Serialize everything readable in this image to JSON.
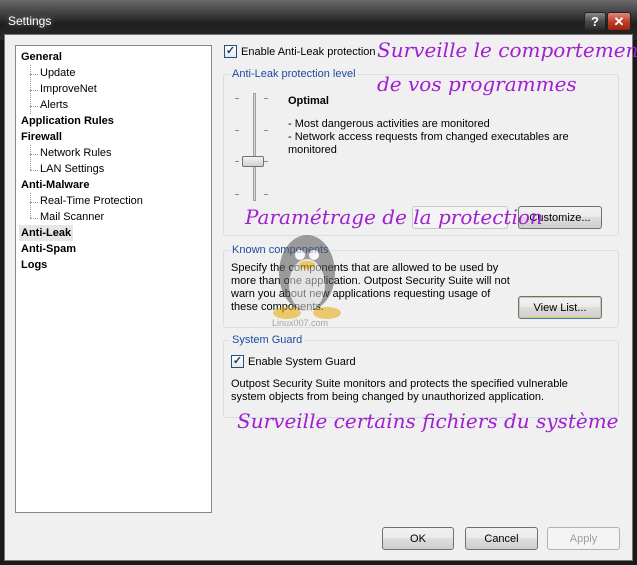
{
  "window": {
    "title": "Settings"
  },
  "titlebar": {
    "help_label": "?",
    "close_label": "✕"
  },
  "tree": {
    "items": [
      {
        "label": "General",
        "level": 0
      },
      {
        "label": "Update",
        "level": 1
      },
      {
        "label": "ImproveNet",
        "level": 1
      },
      {
        "label": "Alerts",
        "level": 1
      },
      {
        "label": "Application Rules",
        "level": 0
      },
      {
        "label": "Firewall",
        "level": 0
      },
      {
        "label": "Network Rules",
        "level": 1
      },
      {
        "label": "LAN Settings",
        "level": 1
      },
      {
        "label": "Anti-Malware",
        "level": 0
      },
      {
        "label": "Real-Time Protection",
        "level": 1
      },
      {
        "label": "Mail Scanner",
        "level": 1
      },
      {
        "label": "Anti-Leak",
        "level": 0,
        "selected": true
      },
      {
        "label": "Anti-Spam",
        "level": 0
      },
      {
        "label": "Logs",
        "level": 0
      }
    ]
  },
  "antileak": {
    "enable_label": "Enable Anti-Leak protection",
    "enabled": true,
    "level_title": "Anti-Leak protection level",
    "level_name": "Optimal",
    "level_desc_1": "- Most dangerous activities are monitored",
    "level_desc_2": "- Network access requests from changed executables are monitored",
    "customize_label": "Customize..."
  },
  "known_components": {
    "title": "Known components",
    "description": "Specify the components that are allowed to be used by more than one application. Outpost Security Suite will not warn you about new applications requesting usage of these components.",
    "view_list_label": "View List..."
  },
  "system_guard": {
    "title": "System Guard",
    "enable_label": "Enable System Guard",
    "enabled": true,
    "description": "Outpost Security Suite monitors and protects the specified vulnerable system objects from being changed by unauthorized application."
  },
  "footer": {
    "ok_label": "OK",
    "cancel_label": "Cancel",
    "apply_label": "Apply"
  },
  "annotations": {
    "a1": "Surveille le comportement",
    "a2": "de vos programmes",
    "a3": "Paramétrage de la protection",
    "a4": "Surveille certains fichiers du système"
  },
  "watermark": {
    "text": "Linux007.com"
  },
  "colors": {
    "annotation": "#a01fd0",
    "group_title": "#1e4ba1"
  }
}
